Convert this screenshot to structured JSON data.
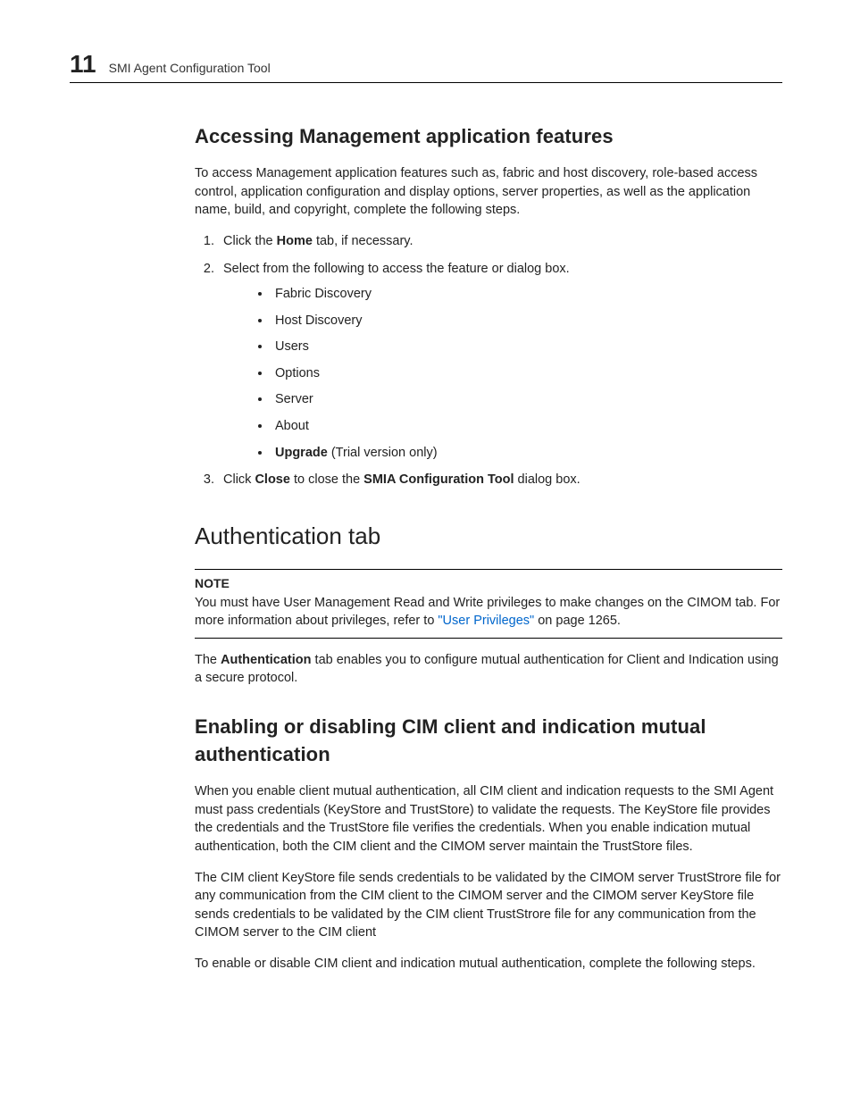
{
  "header": {
    "chapter_number": "11",
    "running_title": "SMI Agent Configuration Tool"
  },
  "section1": {
    "heading": "Accessing Management application features",
    "intro": "To access Management application features such as, fabric and host discovery, role-based access control, application configuration and display options, server properties, as well as the application name, build, and copyright, complete the following steps.",
    "step1_pre": "Click the ",
    "step1_bold": "Home",
    "step1_post": " tab, if necessary.",
    "step2": "Select from the following to access the feature or dialog box.",
    "bullets": {
      "b1": "Fabric Discovery",
      "b2": "Host Discovery",
      "b3": "Users",
      "b4": "Options",
      "b5": "Server",
      "b6": "About",
      "b7_bold": "Upgrade",
      "b7_rest": " (Trial version only)"
    },
    "step3_pre": "Click ",
    "step3_b1": "Close",
    "step3_mid": " to close the ",
    "step3_b2": "SMIA Configuration Tool",
    "step3_post": " dialog box."
  },
  "section2": {
    "heading": "Authentication tab",
    "note_label": "NOTE",
    "note_line1": "You must have User Management Read and Write privileges to make changes on the CIMOM tab. For more information about privileges, refer to ",
    "note_link": "\"User Privileges\"",
    "note_after": " on page 1265.",
    "para_pre": "The ",
    "para_bold": "Authentication",
    "para_post": " tab enables you to configure mutual authentication for Client and Indication using a secure protocol."
  },
  "section3": {
    "heading": "Enabling or disabling CIM client and indication mutual authentication",
    "p1": "When you enable client mutual authentication, all CIM client and indication requests to the SMI Agent must pass credentials (KeyStore and TrustStore) to validate the requests. The KeyStore file provides the credentials and the TrustStore file verifies the credentials. When you enable indication mutual authentication, both the CIM client and the CIMOM server maintain the TrustStore files.",
    "p2": "The CIM client KeyStore file sends credentials to be validated by the CIMOM server TrustStrore file for any communication from the CIM client to the CIMOM server and the CIMOM server KeyStore file sends credentials to be validated by the CIM client TrustStrore file for any communication from the CIMOM server to the CIM client",
    "p3": "To enable or disable CIM client and indication mutual authentication, complete the following steps."
  }
}
